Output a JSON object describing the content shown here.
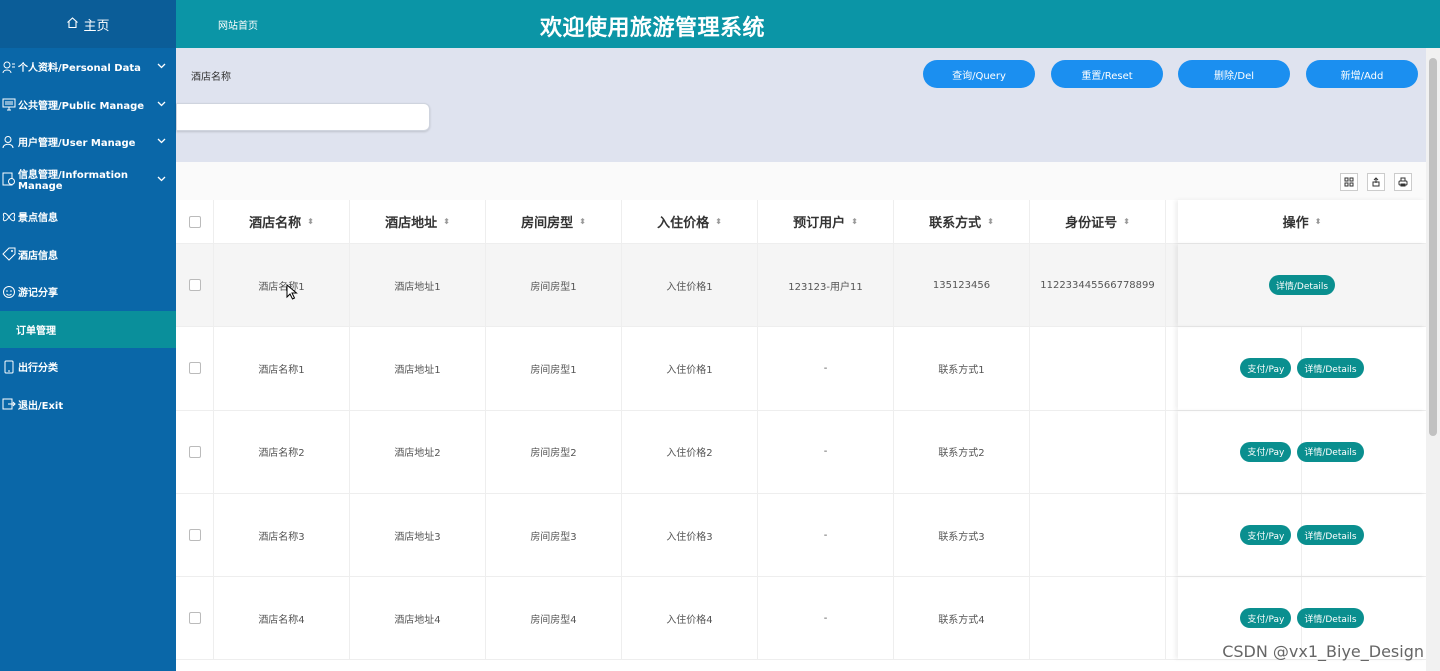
{
  "sidebar": {
    "home_label": "主页",
    "items": [
      {
        "label": "个人资料/Personal Data",
        "icon": "person-card-icon",
        "expandable": true
      },
      {
        "label": "公共管理/Public Manage",
        "icon": "monitor-icon",
        "expandable": true
      },
      {
        "label": "用户管理/User Manage",
        "icon": "user-icon",
        "expandable": true
      },
      {
        "label": "信息管理/Information Manage",
        "icon": "info-gear-icon",
        "expandable": true
      },
      {
        "label": "景点信息",
        "icon": "butterfly-icon",
        "expandable": false
      },
      {
        "label": "酒店信息",
        "icon": "tag-icon",
        "expandable": false
      },
      {
        "label": "游记分享",
        "icon": "circle-face-icon",
        "expandable": false
      },
      {
        "label": "订单管理",
        "icon": "",
        "expandable": false,
        "active": true
      },
      {
        "label": "出行分类",
        "icon": "phone-icon",
        "expandable": false
      },
      {
        "label": "退出/Exit",
        "icon": "exit-icon",
        "expandable": false
      }
    ]
  },
  "topbar": {
    "site_link": "网站首页",
    "title": "欢迎使用旅游管理系统"
  },
  "search": {
    "label": "酒店名称",
    "value": "",
    "buttons": {
      "query": "查询/Query",
      "reset": "重置/Reset",
      "delete": "删除/Del",
      "add": "新增/Add"
    }
  },
  "table": {
    "headers": [
      "酒店名称",
      "酒店地址",
      "房间房型",
      "入住价格",
      "预订用户",
      "联系方式",
      "身份证号",
      "",
      "操作"
    ],
    "rows": [
      {
        "cells": [
          "酒店名称1",
          "酒店地址1",
          "房间房型1",
          "入住价格1",
          "123123-用户11",
          "135123456",
          "112233445566778899",
          ""
        ],
        "pay": false
      },
      {
        "cells": [
          "酒店名称1",
          "酒店地址1",
          "房间房型1",
          "入住价格1",
          "-",
          "联系方式1",
          "",
          ""
        ],
        "pay": true
      },
      {
        "cells": [
          "酒店名称2",
          "酒店地址2",
          "房间房型2",
          "入住价格2",
          "-",
          "联系方式2",
          "",
          ""
        ],
        "pay": true
      },
      {
        "cells": [
          "酒店名称3",
          "酒店地址3",
          "房间房型3",
          "入住价格3",
          "-",
          "联系方式3",
          "",
          ""
        ],
        "pay": true
      },
      {
        "cells": [
          "酒店名称4",
          "酒店地址4",
          "房间房型4",
          "入住价格4",
          "-",
          "联系方式4",
          "",
          ""
        ],
        "pay": true
      }
    ],
    "pay_label": "支付/Pay",
    "details_label": "详情/Details"
  },
  "colors": {
    "sidebar": "#0a67a8",
    "topbar": "#0b95a6",
    "primary_button": "#1b8ff0",
    "op_button": "#0a8f8f"
  },
  "watermark": "CSDN @vx1_Biye_Design"
}
